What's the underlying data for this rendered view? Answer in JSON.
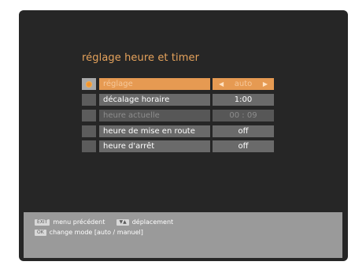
{
  "menu": {
    "title": "réglage heure et timer",
    "rows": [
      {
        "label": "réglage",
        "value": "auto",
        "active": true,
        "disabled": false,
        "arrows": true
      },
      {
        "label": "décalage horaire",
        "value": "1:00",
        "active": false,
        "disabled": false,
        "arrows": false
      },
      {
        "label": "heure actuelle",
        "value": "00 : 09",
        "active": false,
        "disabled": true,
        "arrows": false
      },
      {
        "label": "heure de mise en route",
        "value": "off",
        "active": false,
        "disabled": false,
        "arrows": false
      },
      {
        "label": "heure d'arrêt",
        "value": "off",
        "active": false,
        "disabled": false,
        "arrows": false
      }
    ]
  },
  "help": {
    "back_key": "EXIT",
    "back_text": "menu précédent",
    "nav_key": "▼▲",
    "nav_text": "déplacement",
    "ok_key": "OK",
    "ok_text": "change mode [auto / manuel]"
  },
  "colors": {
    "accent": "#e69a52",
    "title": "#e6a35c",
    "row_bg": "#6a6a6a",
    "panel_bg": "#9a9a9a"
  }
}
